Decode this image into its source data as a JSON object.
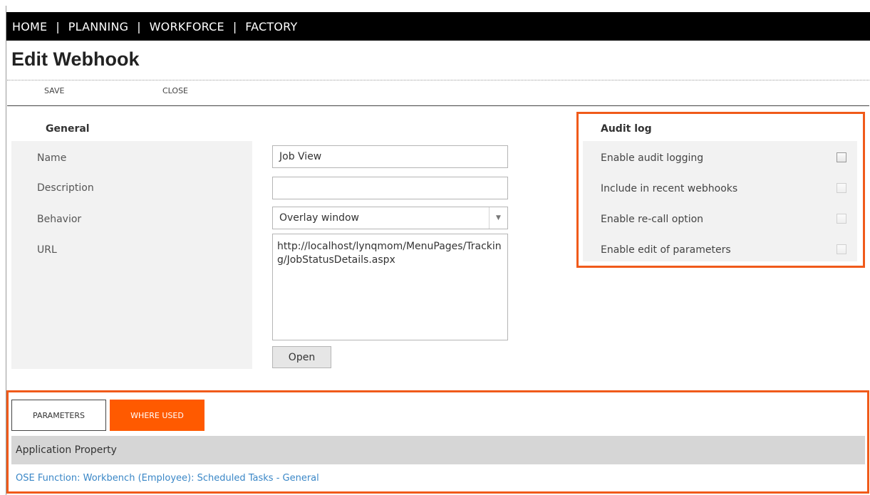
{
  "nav": {
    "items": [
      {
        "label": "HOME"
      },
      {
        "label": "PLANNING"
      },
      {
        "label": "WORKFORCE"
      },
      {
        "label": "FACTORY"
      }
    ],
    "separator": "|"
  },
  "page": {
    "title": "Edit Webhook"
  },
  "toolbar": {
    "save_label": "SAVE",
    "close_label": "CLOSE"
  },
  "general": {
    "section_title": "General",
    "name_label": "Name",
    "name_value": "Job View",
    "description_label": "Description",
    "description_value": "",
    "behavior_label": "Behavior",
    "behavior_value": "Overlay window",
    "url_label": "URL",
    "url_value": "http://localhost/lynqmom/MenuPages/Tracking/JobStatusDetails.aspx",
    "open_label": "Open"
  },
  "audit": {
    "section_title": "Audit log",
    "options": [
      {
        "label": "Enable audit logging",
        "checked": false,
        "enabled": true
      },
      {
        "label": "Include in recent webhooks",
        "checked": false,
        "enabled": false
      },
      {
        "label": "Enable re-call option",
        "checked": false,
        "enabled": false
      },
      {
        "label": "Enable edit of parameters",
        "checked": false,
        "enabled": false
      }
    ]
  },
  "tabs": {
    "parameters_label": "PARAMETERS",
    "where_used_label": "WHERE USED",
    "active": "WHERE USED"
  },
  "where_used": {
    "column_header": "Application Property",
    "rows": [
      {
        "text": "OSE Function: Workbench (Employee): Scheduled Tasks - General"
      }
    ]
  },
  "colors": {
    "accent": "#ff5a00",
    "highlight_border": "#f05a1a",
    "link": "#3a87c7",
    "nav_bg": "#000000"
  }
}
